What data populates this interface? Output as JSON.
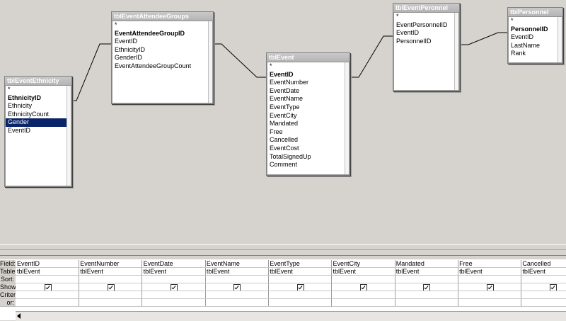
{
  "tables": [
    {
      "id": "ethnicity",
      "title": "tblEventEthnicity",
      "fields": [
        {
          "name": "*"
        },
        {
          "name": "EthnicityID",
          "key": true
        },
        {
          "name": "Ethnicity"
        },
        {
          "name": "EthnicityCount"
        },
        {
          "name": "Gender",
          "selected": true
        },
        {
          "name": "EventID"
        }
      ]
    },
    {
      "id": "attendee",
      "title": "tblEventAttendeeGroups",
      "fields": [
        {
          "name": "*"
        },
        {
          "name": "EventAttendeeGroupID",
          "key": true
        },
        {
          "name": "EventID"
        },
        {
          "name": "EthnicityID"
        },
        {
          "name": "GenderID"
        },
        {
          "name": "EventAttendeeGroupCount"
        }
      ]
    },
    {
      "id": "event",
      "title": "tblEvent",
      "fields": [
        {
          "name": "*"
        },
        {
          "name": "EventID",
          "key": true
        },
        {
          "name": "EventNumber"
        },
        {
          "name": "EventDate"
        },
        {
          "name": "EventName"
        },
        {
          "name": "EventType"
        },
        {
          "name": "EventCity"
        },
        {
          "name": "Mandated"
        },
        {
          "name": "Free"
        },
        {
          "name": "Cancelled"
        },
        {
          "name": "EventCost"
        },
        {
          "name": "TotalSignedUp"
        },
        {
          "name": "Comment"
        }
      ]
    },
    {
      "id": "personnelLink",
      "title": "tblEventPeronnel",
      "fields": [
        {
          "name": "*"
        },
        {
          "name": "EventPersonnelID"
        },
        {
          "name": "EventID"
        },
        {
          "name": "PersonnelID"
        }
      ]
    },
    {
      "id": "personnel",
      "title": "tblPersonnel",
      "fields": [
        {
          "name": "*"
        },
        {
          "name": "PersonnelID",
          "key": true
        },
        {
          "name": "EventID"
        },
        {
          "name": "LastName"
        },
        {
          "name": "Rank"
        }
      ]
    }
  ],
  "grid": {
    "row_labels": [
      "Field:",
      "Table:",
      "Sort:",
      "Show:",
      "Criteria:",
      "or:"
    ],
    "columns": [
      {
        "field": "EventID",
        "table": "tblEvent",
        "show": true
      },
      {
        "field": "EventNumber",
        "table": "tblEvent",
        "show": true
      },
      {
        "field": "EventDate",
        "table": "tblEvent",
        "show": true
      },
      {
        "field": "EventName",
        "table": "tblEvent",
        "show": true
      },
      {
        "field": "EventType",
        "table": "tblEvent",
        "show": true
      },
      {
        "field": "EventCity",
        "table": "tblEvent",
        "show": true
      },
      {
        "field": "Mandated",
        "table": "tblEvent",
        "show": true
      },
      {
        "field": "Free",
        "table": "tblEvent",
        "show": true
      },
      {
        "field": "Cancelled",
        "table": "tblEvent",
        "show": true
      }
    ]
  }
}
